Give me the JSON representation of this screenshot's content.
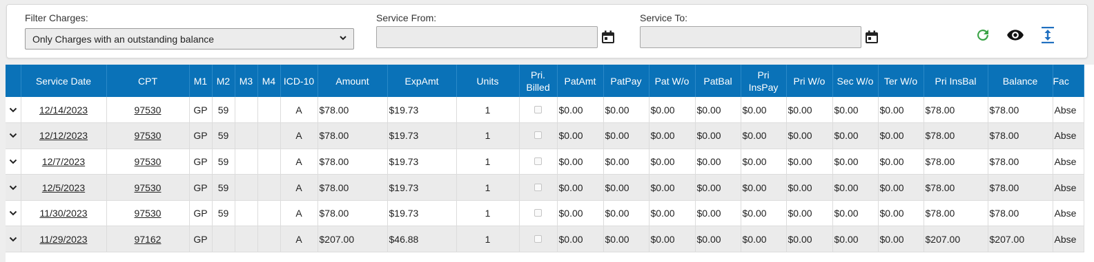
{
  "filters": {
    "filter_charges_label": "Filter Charges:",
    "filter_charges_value": "Only Charges with an outstanding balance",
    "service_from_label": "Service From:",
    "service_from_value": "",
    "service_to_label": "Service To:",
    "service_to_value": ""
  },
  "toolbar": {
    "refresh_icon": "refresh-icon",
    "view_icon": "eye-icon",
    "expand_icon": "expand-vertical-icon",
    "refresh_color": "#3aa346",
    "expand_color": "#1f6fc0"
  },
  "grid": {
    "header_color": "#0a72b8",
    "columns": [
      "",
      "Service Date",
      "CPT",
      "M1",
      "M2",
      "M3",
      "M4",
      "ICD-10",
      "Amount",
      "ExpAmt",
      "Units",
      "Pri.\nBilled",
      "PatAmt",
      "PatPay",
      "Pat W/o",
      "PatBal",
      "Pri\nInsPay",
      "Pri W/o",
      "Sec W/o",
      "Ter W/o",
      "Pri InsBal",
      "Balance",
      "Fac"
    ],
    "rows": [
      {
        "date": "12/14/2023",
        "cpt": "97530",
        "m1": "GP",
        "m2": "59",
        "m3": "",
        "m4": "",
        "icd": "A",
        "amount": "$78.00",
        "expamt": "$19.73",
        "units": "1",
        "patamt": "$0.00",
        "patpay": "$0.00",
        "patwo": "$0.00",
        "patbal": "$0.00",
        "priinspay": "$0.00",
        "priwo": "$0.00",
        "secwo": "$0.00",
        "terwo": "$0.00",
        "priinsbal": "$78.00",
        "balance": "$78.00",
        "fac": "Abse"
      },
      {
        "date": "12/12/2023",
        "cpt": "97530",
        "m1": "GP",
        "m2": "59",
        "m3": "",
        "m4": "",
        "icd": "A",
        "amount": "$78.00",
        "expamt": "$19.73",
        "units": "1",
        "patamt": "$0.00",
        "patpay": "$0.00",
        "patwo": "$0.00",
        "patbal": "$0.00",
        "priinspay": "$0.00",
        "priwo": "$0.00",
        "secwo": "$0.00",
        "terwo": "$0.00",
        "priinsbal": "$78.00",
        "balance": "$78.00",
        "fac": "Abse"
      },
      {
        "date": "12/7/2023",
        "cpt": "97530",
        "m1": "GP",
        "m2": "59",
        "m3": "",
        "m4": "",
        "icd": "A",
        "amount": "$78.00",
        "expamt": "$19.73",
        "units": "1",
        "patamt": "$0.00",
        "patpay": "$0.00",
        "patwo": "$0.00",
        "patbal": "$0.00",
        "priinspay": "$0.00",
        "priwo": "$0.00",
        "secwo": "$0.00",
        "terwo": "$0.00",
        "priinsbal": "$78.00",
        "balance": "$78.00",
        "fac": "Abse"
      },
      {
        "date": "12/5/2023",
        "cpt": "97530",
        "m1": "GP",
        "m2": "59",
        "m3": "",
        "m4": "",
        "icd": "A",
        "amount": "$78.00",
        "expamt": "$19.73",
        "units": "1",
        "patamt": "$0.00",
        "patpay": "$0.00",
        "patwo": "$0.00",
        "patbal": "$0.00",
        "priinspay": "$0.00",
        "priwo": "$0.00",
        "secwo": "$0.00",
        "terwo": "$0.00",
        "priinsbal": "$78.00",
        "balance": "$78.00",
        "fac": "Abse"
      },
      {
        "date": "11/30/2023",
        "cpt": "97530",
        "m1": "GP",
        "m2": "59",
        "m3": "",
        "m4": "",
        "icd": "A",
        "amount": "$78.00",
        "expamt": "$19.73",
        "units": "1",
        "patamt": "$0.00",
        "patpay": "$0.00",
        "patwo": "$0.00",
        "patbal": "$0.00",
        "priinspay": "$0.00",
        "priwo": "$0.00",
        "secwo": "$0.00",
        "terwo": "$0.00",
        "priinsbal": "$78.00",
        "balance": "$78.00",
        "fac": "Abse"
      },
      {
        "date": "11/29/2023",
        "cpt": "97162",
        "m1": "GP",
        "m2": "",
        "m3": "",
        "m4": "",
        "icd": "A",
        "amount": "$207.00",
        "expamt": "$46.88",
        "units": "1",
        "patamt": "$0.00",
        "patpay": "$0.00",
        "patwo": "$0.00",
        "patbal": "$0.00",
        "priinspay": "$0.00",
        "priwo": "$0.00",
        "secwo": "$0.00",
        "terwo": "$0.00",
        "priinsbal": "$207.00",
        "balance": "$207.00",
        "fac": "Abse"
      }
    ]
  }
}
